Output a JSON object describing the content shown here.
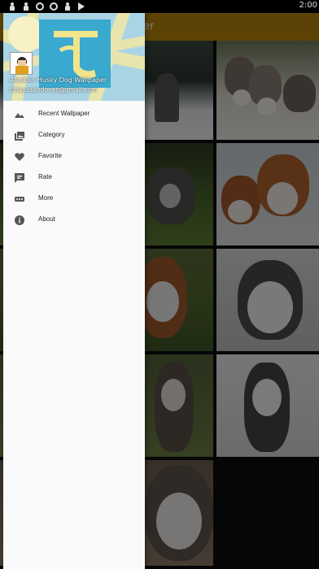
{
  "status_bar": {
    "time": "2:00"
  },
  "app_bar": {
    "title_visible_fragment": "er"
  },
  "drawer": {
    "header": {
      "title": "Alaskan Husky Dog Wallpaper",
      "email": "tittayasandones@gmail.com"
    },
    "menu": [
      {
        "label": "Recent Wallpaper",
        "icon": "landscape-icon"
      },
      {
        "label": "Category",
        "icon": "photo-library-icon"
      },
      {
        "label": "Favorite",
        "icon": "heart-icon"
      },
      {
        "label": "Rate",
        "icon": "rate-review-icon"
      },
      {
        "label": "More",
        "icon": "more-dots-icon"
      },
      {
        "label": "About",
        "icon": "info-icon"
      }
    ]
  },
  "colors": {
    "app_bar": "#b9860a",
    "drawer_bg": "#fafafa",
    "scrim": "rgba(0,0,0,0.5)"
  }
}
